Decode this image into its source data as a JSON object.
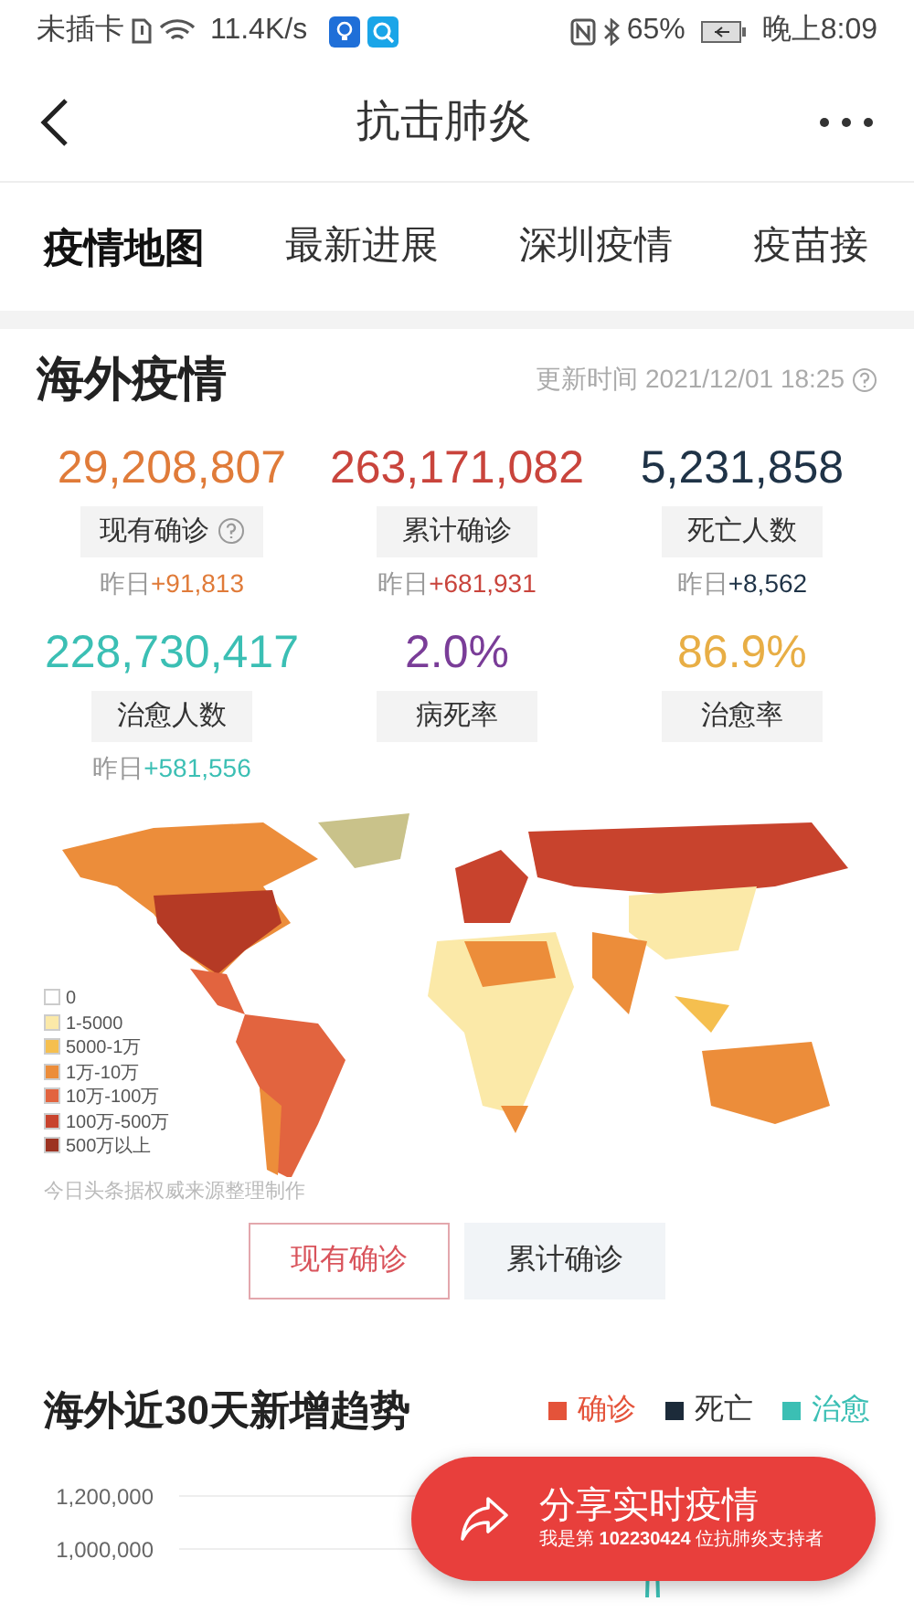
{
  "status_bar": {
    "carrier": "未插卡",
    "speed": "11.4K/s",
    "battery": "65%",
    "time": "晚上8:09"
  },
  "header": {
    "title": "抗击肺炎"
  },
  "tabs": [
    {
      "label": "疫情地图",
      "selected": true
    },
    {
      "label": "最新进展",
      "selected": false
    },
    {
      "label": "深圳疫情",
      "selected": false
    },
    {
      "label": "疫苗接",
      "selected": false
    }
  ],
  "overview": {
    "title": "海外疫情",
    "update_time": "更新时间 2021/12/01 18:25",
    "stats": [
      {
        "value": "29,208,807",
        "label": "现有确诊",
        "help": true,
        "delta_prefix": "昨日",
        "delta": "+91,813",
        "color": "#e07b39"
      },
      {
        "value": "263,171,082",
        "label": "累计确诊",
        "help": false,
        "delta_prefix": "昨日",
        "delta": "+681,931",
        "color": "#c9443c"
      },
      {
        "value": "5,231,858",
        "label": "死亡人数",
        "help": false,
        "delta_prefix": "昨日",
        "delta": "+8,562",
        "color": "#1f3347"
      },
      {
        "value": "228,730,417",
        "label": "治愈人数",
        "help": false,
        "delta_prefix": "昨日",
        "delta": "+581,556",
        "color": "#3bbfb4"
      },
      {
        "value": "2.0%",
        "label": "病死率",
        "help": false,
        "color": "#7a3d98"
      },
      {
        "value": "86.9%",
        "label": "治愈率",
        "help": false,
        "color": "#e8ae45"
      }
    ]
  },
  "map": {
    "legend": [
      {
        "label": "0",
        "color": "#ffffff"
      },
      {
        "label": "1-5000",
        "color": "#fbe9a8"
      },
      {
        "label": "5000-1万",
        "color": "#f5bf4f"
      },
      {
        "label": "1万-10万",
        "color": "#ec8d3a"
      },
      {
        "label": "10万-100万",
        "color": "#e2643f"
      },
      {
        "label": "100万-500万",
        "color": "#c8432d"
      },
      {
        "label": "500万以上",
        "color": "#9c3322"
      }
    ],
    "source": "今日头条据权威来源整理制作"
  },
  "map_toggle": [
    {
      "label": "现有确诊",
      "selected": true
    },
    {
      "label": "累计确诊",
      "selected": false
    }
  ],
  "trend": {
    "title": "海外近30天新增趋势",
    "legend": [
      {
        "label": "确诊",
        "color": "#e4533a"
      },
      {
        "label": "死亡",
        "color": "#1c2b3a"
      },
      {
        "label": "治愈",
        "color": "#3bbfb4"
      }
    ],
    "y_axis_labels": [
      "1,200,000",
      "1,000,000"
    ]
  },
  "share_button": {
    "title": "分享实时疫情",
    "subtitle": "我是第 **102230424** 位抗肺炎支持者"
  }
}
